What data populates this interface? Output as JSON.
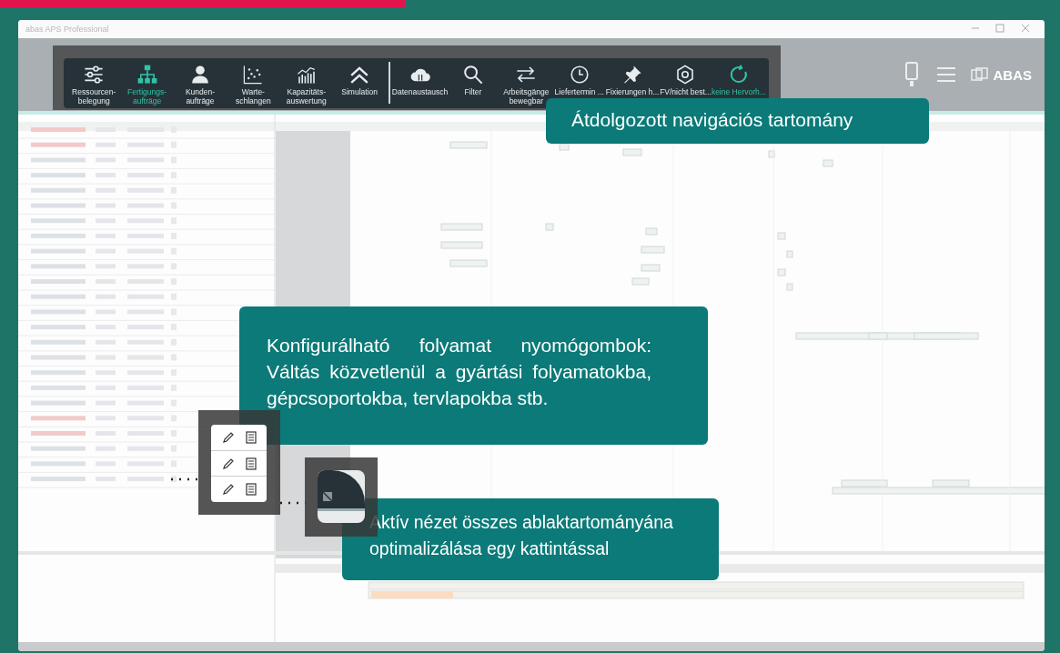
{
  "window": {
    "title": "abas APS Professional",
    "logo": "ABAS"
  },
  "toolbar": {
    "groups": [
      [
        {
          "lines": [
            "Ressourcen-",
            "belegung"
          ],
          "kind": "sliders",
          "selected": false
        },
        {
          "lines": [
            "Fertigungs-",
            "aufträge"
          ],
          "kind": "org",
          "selected": true
        },
        {
          "lines": [
            "Kunden-",
            "aufträge"
          ],
          "kind": "person",
          "selected": false
        },
        {
          "lines": [
            "Warte-",
            "schlangen"
          ],
          "kind": "scatter",
          "selected": false
        },
        {
          "lines": [
            "Kapazitäts-",
            "auswertung"
          ],
          "kind": "bars",
          "selected": false
        },
        {
          "lines": [
            "Simulation"
          ],
          "kind": "chevrons",
          "selected": false
        }
      ],
      [
        {
          "lines": [
            "Datenaustausch"
          ],
          "kind": "cloud",
          "selected": false
        },
        {
          "lines": [
            "Filter"
          ],
          "kind": "search",
          "selected": false
        },
        {
          "lines": [
            "Arbeitsgänge",
            "bewegbar"
          ],
          "kind": "arrows",
          "selected": false
        },
        {
          "lines": [
            "Liefertermin ..."
          ],
          "kind": "clock",
          "selected": false
        },
        {
          "lines": [
            "Fixierungen h..."
          ],
          "kind": "pin",
          "selected": false
        },
        {
          "lines": [
            "FV/nicht best..."
          ],
          "kind": "hex",
          "selected": false
        },
        {
          "lines": [
            "keine Hervorh..."
          ],
          "kind": "refresh",
          "selected": true
        }
      ]
    ]
  },
  "callouts": [
    {
      "text": "Átdolgozott navigációs tartomány"
    },
    {
      "text": "Konfigurálható folyamat nyomógombok: Váltás közvetlenül a gyártási folyamatokba, gépcsoportokba, tervlapokba stb."
    },
    {
      "text": "Aktív nézet összes ablaktartományána optimalizálása egy kattintással"
    }
  ],
  "action_popup": {
    "rows": [
      {
        "kind": "edit-notes"
      },
      {
        "kind": "edit-notes"
      },
      {
        "kind": "edit-notes"
      }
    ]
  }
}
